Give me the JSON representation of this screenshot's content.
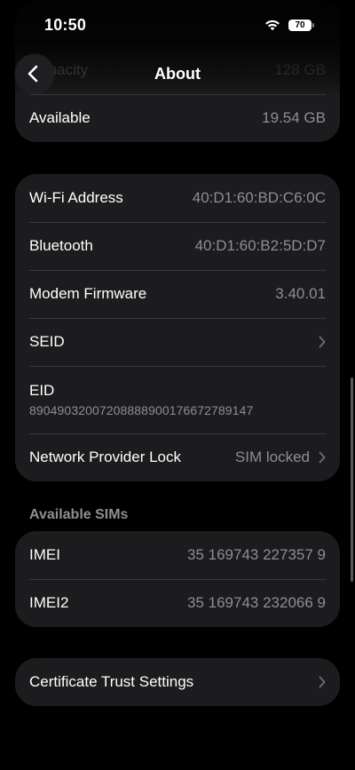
{
  "status_bar": {
    "time": "10:50",
    "battery_level": "70"
  },
  "nav": {
    "title": "About"
  },
  "storage_group": {
    "rows": [
      {
        "label": "Capacity",
        "value": "128 GB"
      },
      {
        "label": "Available",
        "value": "19.54 GB"
      }
    ]
  },
  "network_group": {
    "wifi_address": {
      "label": "Wi-Fi Address",
      "value": "40:D1:60:BD:C6:0C"
    },
    "bluetooth": {
      "label": "Bluetooth",
      "value": "40:D1:60:B2:5D:D7"
    },
    "modem_firmware": {
      "label": "Modem Firmware",
      "value": "3.40.01"
    },
    "seid": {
      "label": "SEID"
    },
    "eid": {
      "label": "EID",
      "value": "89049032007208888900176672789147"
    },
    "network_provider_lock": {
      "label": "Network Provider Lock",
      "value": "SIM locked"
    }
  },
  "sims_section": {
    "header": "Available SIMs",
    "rows": [
      {
        "label": "IMEI",
        "value": "35 169743 227357 9"
      },
      {
        "label": "IMEI2",
        "value": "35 169743 232066 9"
      }
    ]
  },
  "trust_group": {
    "label": "Certificate Trust Settings"
  },
  "colors": {
    "background": "#000000",
    "group_background": "#1c1c1e",
    "separator": "#38383a",
    "secondary_text": "#8e8e93"
  },
  "icons": {
    "back": "chevron-left-icon",
    "wifi": "wifi-icon",
    "battery": "battery-icon",
    "disclosure": "chevron-right-icon"
  }
}
